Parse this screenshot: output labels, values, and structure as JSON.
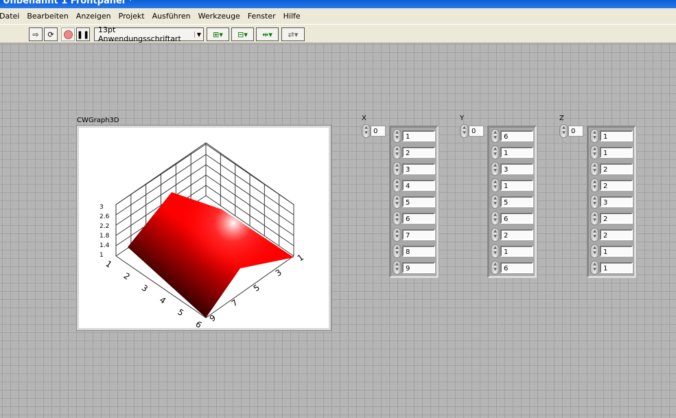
{
  "window": {
    "title": "Unbenannt 1 Frontpanel *"
  },
  "menu": [
    "Datei",
    "Bearbeiten",
    "Anzeigen",
    "Projekt",
    "Ausführen",
    "Werkzeuge",
    "Fenster",
    "Hilfe"
  ],
  "toolbar": {
    "font": "13pt Anwendungsschriftart",
    "icons": [
      "run-arrow-icon",
      "run-continuously-icon",
      "abort-icon",
      "pause-icon",
      "align-icon",
      "distribute-icon",
      "resize-icon",
      "reorder-icon"
    ]
  },
  "graph": {
    "label": "CWGraph3D",
    "z_ticks": [
      "1",
      "1.4",
      "1.8",
      "2.2",
      "2.6",
      "3"
    ],
    "left_ticks": [
      "1",
      "2",
      "3",
      "4",
      "5",
      "6"
    ],
    "right_ticks": [
      "1",
      "3",
      "5",
      "7",
      "9"
    ],
    "surface_color": "#ff0000"
  },
  "arrays": [
    {
      "label": "X",
      "index": "0",
      "values": [
        "1",
        "2",
        "3",
        "4",
        "5",
        "6",
        "7",
        "8",
        "9"
      ]
    },
    {
      "label": "Y",
      "index": "0",
      "values": [
        "6",
        "1",
        "3",
        "1",
        "5",
        "6",
        "2",
        "1",
        "6"
      ]
    },
    {
      "label": "Z",
      "index": "0",
      "values": [
        "1",
        "1",
        "2",
        "2",
        "3",
        "2",
        "2",
        "1",
        "1"
      ]
    }
  ]
}
